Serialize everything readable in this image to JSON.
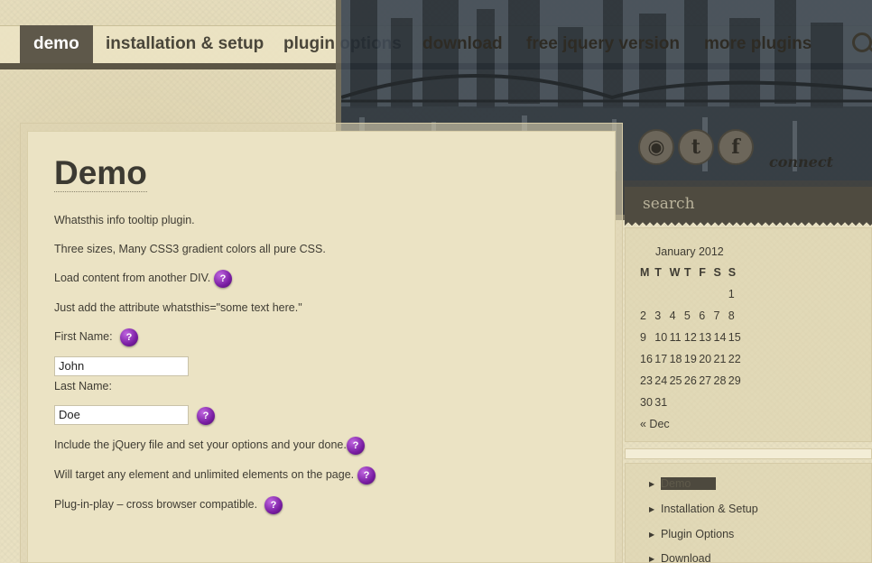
{
  "nav": {
    "items": [
      "demo",
      "installation & setup",
      "plugin options",
      "download",
      "free jquery version",
      "more plugins"
    ],
    "active": "demo"
  },
  "header": {
    "connect_label": "connect",
    "social_icons": [
      "rss-icon",
      "twitter-icon",
      "facebook-icon"
    ],
    "search_placeholder": "search"
  },
  "main": {
    "title": "Demo",
    "paragraphs": {
      "p1": "Whatsthis info tooltip plugin.",
      "p2": "Three sizes, Many CSS3 gradient colors all pure CSS.",
      "p3": "Load content from another DIV.",
      "p4": "Just add the attribute whatsthis=\"some text here.\"",
      "p5": "Include the jQuery file and set your options and your done.",
      "p6": "Will target any element and unlimited elements on the page.",
      "p7": "Plug-in-play – cross browser compatible."
    },
    "first_name_label": "First Name:",
    "first_name_value": "John",
    "last_name_label": "Last Name:",
    "last_name_value": "Doe",
    "help_glyph": "?"
  },
  "calendar": {
    "caption": "January 2012",
    "weekdays": [
      "M",
      "T",
      "W",
      "T",
      "F",
      "S",
      "S"
    ],
    "weeks": [
      [
        "",
        "",
        "",
        "",
        "",
        "",
        "1"
      ],
      [
        "2",
        "3",
        "4",
        "5",
        "6",
        "7",
        "8"
      ],
      [
        "9",
        "10",
        "11",
        "12",
        "13",
        "14",
        "15"
      ],
      [
        "16",
        "17",
        "18",
        "19",
        "20",
        "21",
        "22"
      ],
      [
        "23",
        "24",
        "25",
        "26",
        "27",
        "28",
        "29"
      ],
      [
        "30",
        "31",
        "",
        "",
        "",
        "",
        ""
      ]
    ],
    "prev_link": "« Dec"
  },
  "sidebar": {
    "items": [
      "Demo",
      "Installation & Setup",
      "Plugin Options",
      "Download"
    ],
    "arrow_glyph": "▶"
  },
  "colors": {
    "accent": "#5e584a",
    "help_icon": "#7a1ea3",
    "background": "#e9e1c2"
  }
}
